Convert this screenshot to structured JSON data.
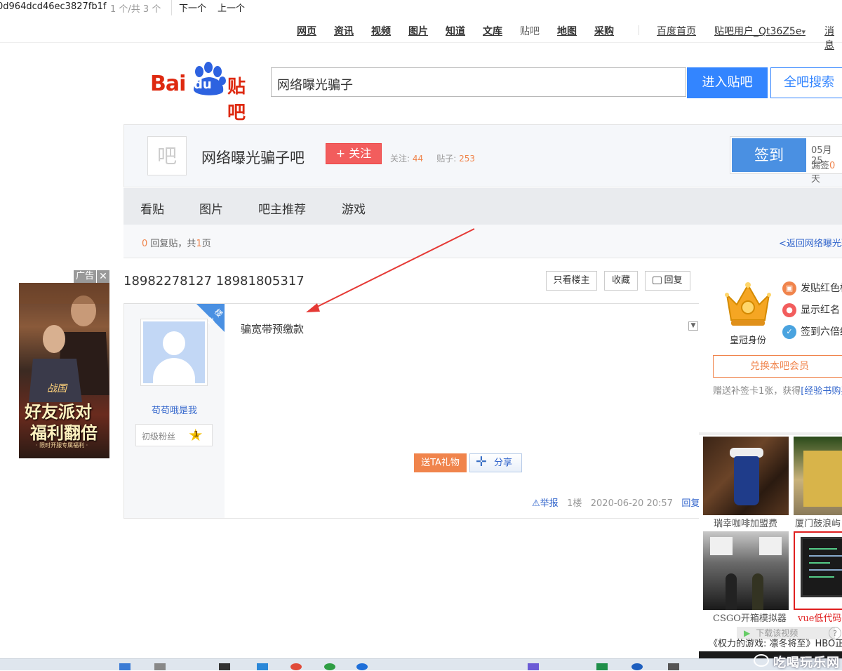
{
  "findbar": {
    "query": "0d964dcd46ec3827fb1f",
    "count": "1 个/共 3 个",
    "next": "下一个",
    "prev": "上一个"
  },
  "topnav": {
    "links": [
      "网页",
      "资讯",
      "视频",
      "图片",
      "知道",
      "文库",
      "贴吧",
      "地图",
      "采购"
    ],
    "home": "百度首页",
    "user": "贴吧用户_Qt36Z5e",
    "user_arrow": "▾",
    "messages": "消息"
  },
  "logo": {
    "bai": "Bai",
    "du": "du",
    "tieba": "贴吧"
  },
  "search": {
    "value": "网络曝光骗子",
    "enter_label": "进入贴吧",
    "all_label": "全吧搜索"
  },
  "forum": {
    "icon_text": "吧",
    "name": "网络曝光骗子吧",
    "follow_label": "+ 关注",
    "follow_label_prefix": "关注:",
    "follow_count": "44",
    "posts_label": "贴子:",
    "posts_count": "253",
    "sign_label": "签到",
    "sign_date": "05月25",
    "sign_missed_prefix": "漏签",
    "sign_missed_count": "0",
    "sign_missed_suffix": "天"
  },
  "tabs": [
    "看贴",
    "图片",
    "吧主推荐",
    "游戏"
  ],
  "pager": {
    "reply_count": "0",
    "reply_text": "回复贴，共",
    "pages": "1",
    "pages_suffix": "页",
    "back_link": "<返回网络曝光骗子吧"
  },
  "ad": {
    "tag": "广告",
    "close": "✕",
    "headline1": "好友派对",
    "headline2": "福利翻倍",
    "tiny": "· 限时开服专属福利 ·",
    "brand": "战国"
  },
  "post": {
    "title": "18982278127 18981805317",
    "only_owner": "只看楼主",
    "favorite": "收藏",
    "reply": "回复",
    "owner_tag": "楼主",
    "author": "苟苟哦是我",
    "level_name": "初级粉丝",
    "level_num": "1",
    "content": "骗宽带预缴款",
    "gift_label": "送TA礼物",
    "share_label": "分享",
    "report": "举报",
    "floor": "1楼",
    "time": "2020-06-20 20:57",
    "reply_link": "回复"
  },
  "sidebar": {
    "crown_label": "皇冠身份",
    "perks": [
      "发贴红色标题",
      "显示红名",
      "签到六倍经验"
    ],
    "exchange_label": "兑换本吧会员",
    "bonus_text": "赠送补签卡1张，获得",
    "bonus_link": "[经验书购买权]",
    "tiles": [
      {
        "caption": "瑞幸咖啡加盟费"
      },
      {
        "caption": "厦门鼓浪屿"
      },
      {
        "caption": "CSGO开箱模拟器"
      },
      {
        "caption": "vue低代码"
      }
    ],
    "download_video": "下载该视频",
    "help": "?",
    "bottom_title": "《权力的游戏: 凛冬将至》HBO正版授权"
  },
  "watermark": "吃喝玩乐网",
  "colors": {
    "brand_red": "#de2910",
    "brand_blue": "#3385ff",
    "accent_orange": "#f0844c",
    "link_blue": "#3366cc"
  }
}
